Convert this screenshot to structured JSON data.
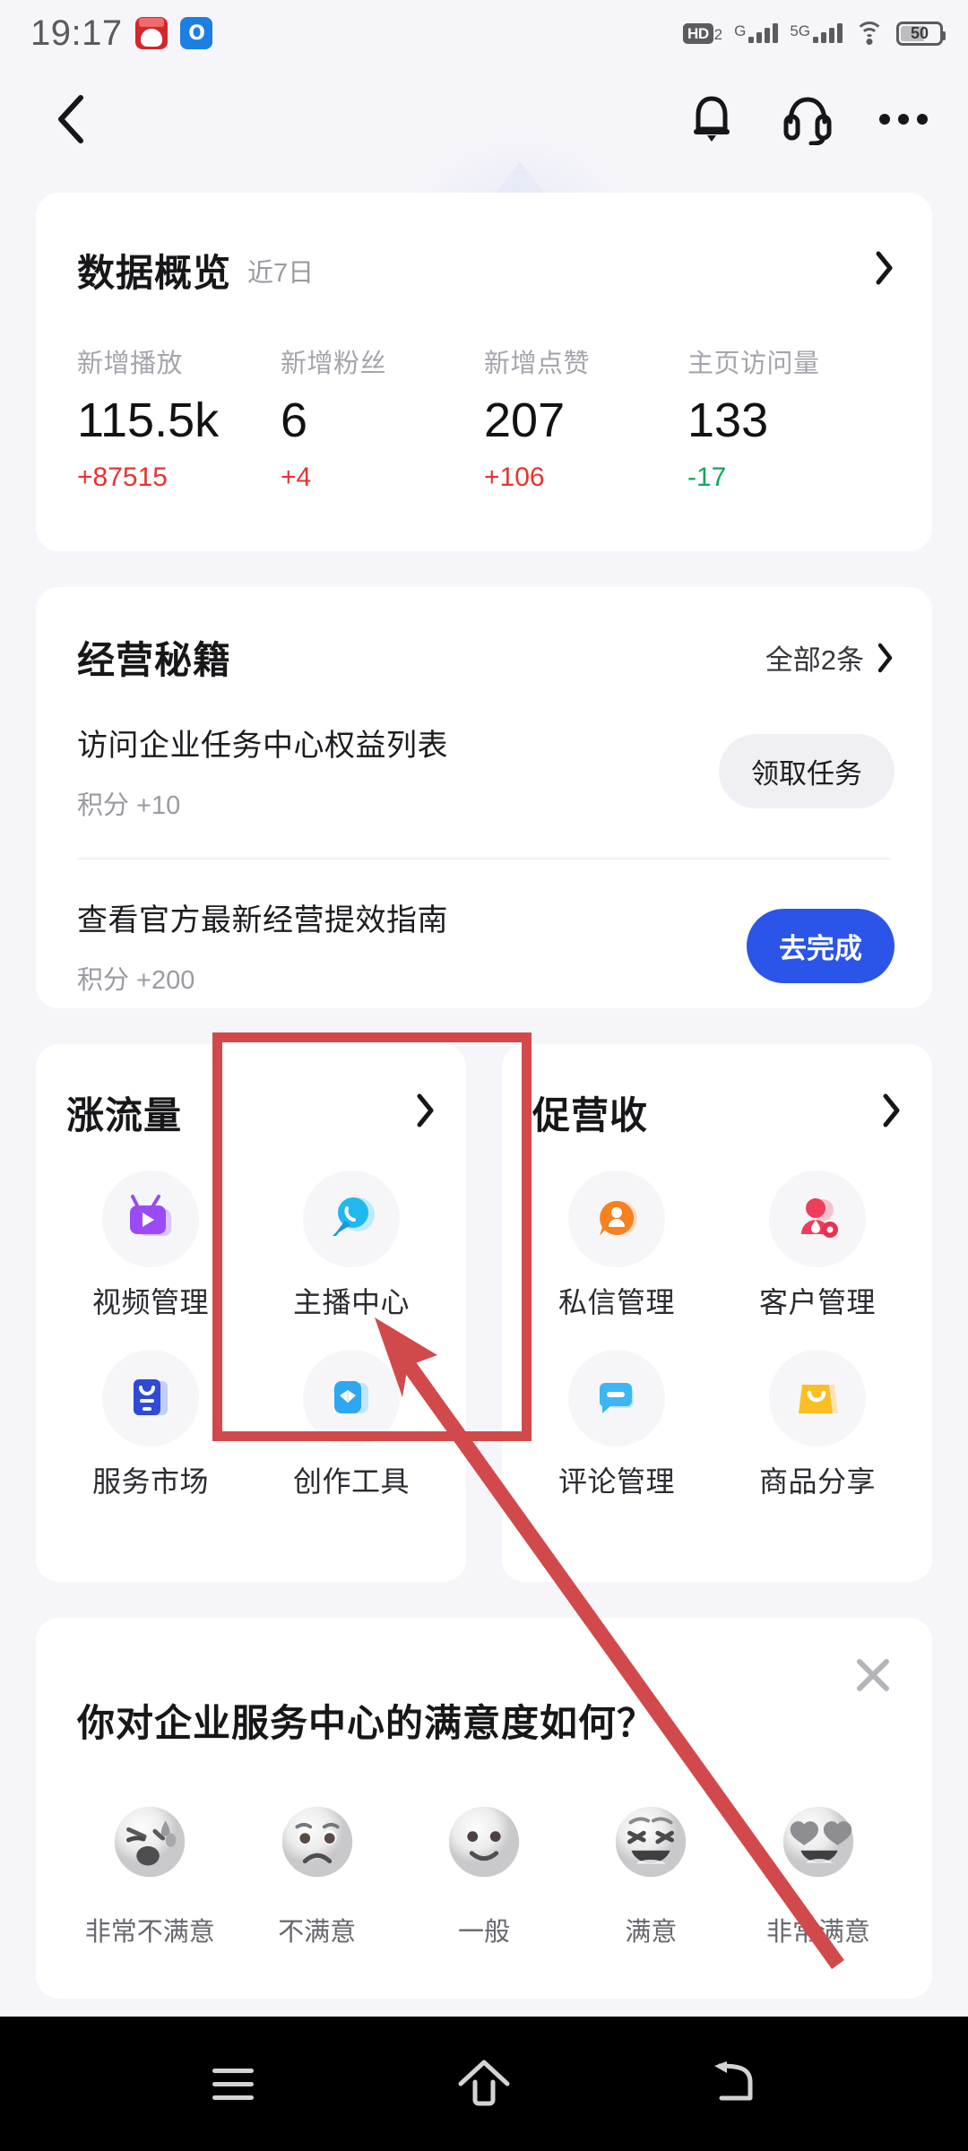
{
  "status_bar": {
    "time": "19:17",
    "app_icons": [
      {
        "name": "panda-app-icon",
        "glyph": ""
      },
      {
        "name": "bull-app-icon",
        "glyph": "Օ"
      }
    ],
    "hd_label": "HD",
    "hd_sub": "2",
    "sim1_network": "G",
    "sim2_network": "5G",
    "wifi": "wifi-icon",
    "battery_percent": "50"
  },
  "navbar": {
    "back": "back-icon",
    "bell": "bell-icon",
    "headset": "headset-icon",
    "more": "more-icon"
  },
  "data_overview": {
    "title": "数据概览",
    "subtitle": "近7日",
    "metrics": [
      {
        "label": "新增播放",
        "value": "115.5k",
        "delta": "+87515",
        "delta_color": "#e8332f"
      },
      {
        "label": "新增粉丝",
        "value": "6",
        "delta": "+4",
        "delta_color": "#e8332f"
      },
      {
        "label": "新增点赞",
        "value": "207",
        "delta": "+106",
        "delta_color": "#e8332f"
      },
      {
        "label": "主页访问量",
        "value": "133",
        "delta": "-17",
        "delta_color": "#11a75c"
      }
    ]
  },
  "business_tips": {
    "title": "经营秘籍",
    "see_all": "全部2条",
    "items": [
      {
        "name": "访问企业任务中心权益列表",
        "points": "积分 +10",
        "button": "领取任务",
        "style": "grey"
      },
      {
        "name": "查看官方最新经营提效指南",
        "points": "积分 +200",
        "button": "去完成",
        "style": "blue"
      }
    ]
  },
  "feature_cards": [
    {
      "title": "涨流量",
      "items": [
        {
          "label": "视频管理",
          "icon": "tv-play-icon",
          "color": "#9a4bf5"
        },
        {
          "label": "主播中心",
          "icon": "live-mic-icon",
          "color": "#20b9ef"
        },
        {
          "label": "服务市场",
          "icon": "service-bag-icon",
          "color": "#2f49d8"
        },
        {
          "label": "创作工具",
          "icon": "create-tool-icon",
          "color": "#2ea7f2"
        }
      ]
    },
    {
      "title": "促营收",
      "items": [
        {
          "label": "私信管理",
          "icon": "message-user-icon",
          "color": "#f5821f"
        },
        {
          "label": "客户管理",
          "icon": "customer-gear-icon",
          "color": "#ef3e5c"
        },
        {
          "label": "评论管理",
          "icon": "comment-icon",
          "color": "#3cb6f5"
        },
        {
          "label": "商品分享",
          "icon": "shopping-bag-icon",
          "color": "#fbbf25"
        }
      ]
    }
  ],
  "survey": {
    "question": "你对企业服务中心的满意度如何？",
    "close": "close-icon",
    "options": [
      {
        "label": "非常不满意",
        "face": "angry-face"
      },
      {
        "label": "不满意",
        "face": "sad-face"
      },
      {
        "label": "一般",
        "face": "neutral-face"
      },
      {
        "label": "满意",
        "face": "happy-face"
      },
      {
        "label": "非常满意",
        "face": "heart-eyes-face"
      }
    ]
  },
  "annotation": {
    "highlight_target": "主播中心",
    "color": "#d2494c"
  },
  "system_nav": {
    "recents": "menu-icon",
    "home": "home-icon",
    "back": "back-nav-icon"
  }
}
